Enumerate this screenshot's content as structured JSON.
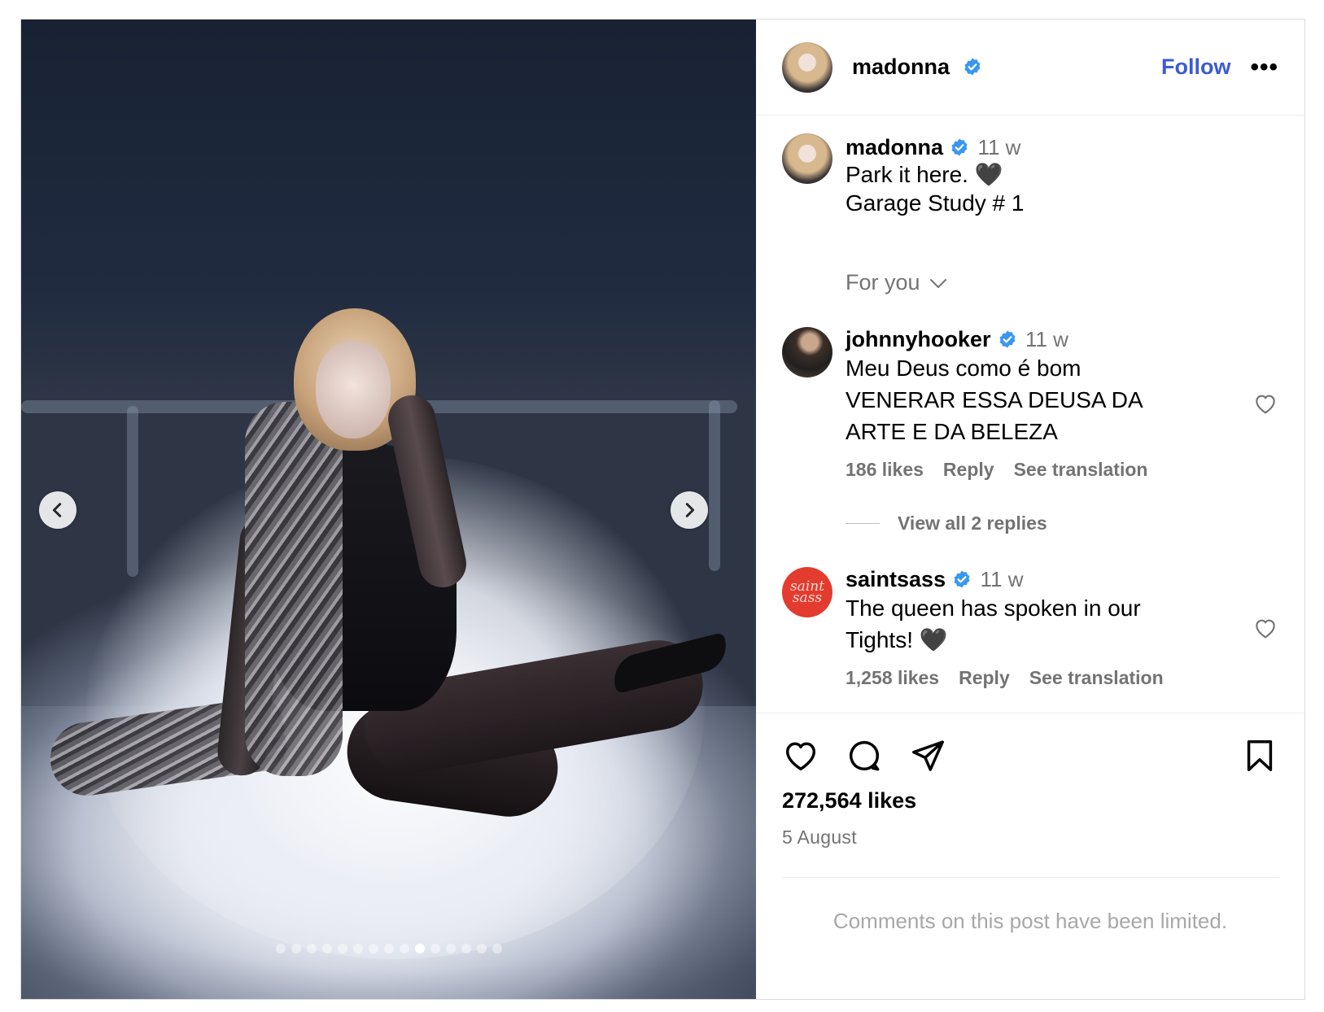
{
  "post": {
    "media": {
      "alt": "",
      "slide_count": 15,
      "active_slide": 10
    },
    "header": {
      "username": "madonna",
      "verified": true,
      "follow_label": "Follow",
      "more_label": "•••"
    },
    "caption": {
      "username": "madonna",
      "time": "11 w",
      "line1": "Park it here. 🖤",
      "line2": "Garage Study # 1"
    },
    "for_you_label": "For you",
    "comments": [
      {
        "username": "johnnyhooker",
        "time": "11 w",
        "text_line1": "Meu Deus como é bom",
        "text_line2": "VENERAR ESSA DEUSA DA",
        "text_line3": "ARTE E DA BELEZA",
        "likes": "186 likes",
        "reply_label": "Reply",
        "translate_label": "See translation"
      },
      {
        "username": "saintsass",
        "avatar_text": "saint sass",
        "time": "11 w",
        "text_line1": "The queen has spoken in our",
        "text_line2": "Tights! 🖤",
        "likes": "1,258 likes",
        "reply_label": "Reply",
        "translate_label": "See translation"
      }
    ],
    "view_replies_label": "View all 2 replies",
    "likes_count": "272,564 likes",
    "date": "5 August",
    "limited_notice": "Comments on this post have been limited.",
    "colors": {
      "link_blue": "#3b5bd6",
      "verified_blue": "#3897f0",
      "muted_text": "#737373"
    }
  }
}
